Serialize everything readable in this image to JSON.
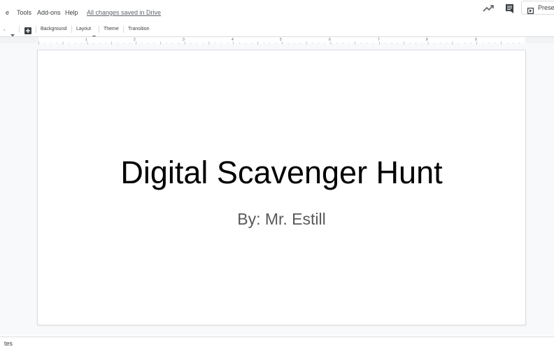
{
  "menubar": {
    "items": [
      "e",
      "Tools",
      "Add-ons",
      "Help"
    ],
    "saved_status": "All changes saved in Drive",
    "present_label": "Prese"
  },
  "toolbar": {
    "caret": ",",
    "background_label": "Background",
    "layout_label": "Layout",
    "theme_label": "Theme",
    "transition_label": "Transition"
  },
  "ruler": {
    "numbers": [
      "1",
      "2",
      "3",
      "4",
      "5",
      "6",
      "7",
      "8",
      "9"
    ]
  },
  "slide": {
    "title": "Digital Scavenger Hunt",
    "subtitle": "By: Mr. Estill"
  },
  "notes": {
    "label": "tes"
  },
  "icons": {
    "activity": "trending-up-icon",
    "comments": "comment-icon",
    "present": "present-icon",
    "new_slide": "new-slide-icon"
  },
  "colors": {
    "title_text": "#000000",
    "subtitle_text": "#595959",
    "canvas_bg": "#f8f9fa",
    "saved_link": "#5f6368"
  }
}
